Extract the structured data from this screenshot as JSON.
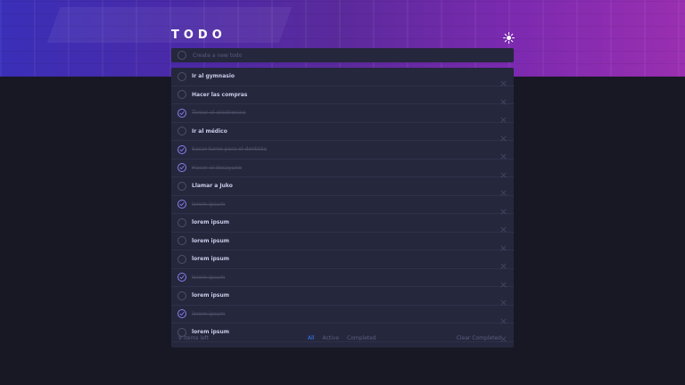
{
  "header": {
    "title": "TODO",
    "theme_toggle_icon": "sun-icon"
  },
  "create": {
    "placeholder": "Create a new todo"
  },
  "todos": [
    {
      "text": "Ir al gymnasio",
      "completed": false
    },
    {
      "text": "Hacer las compras",
      "completed": false
    },
    {
      "text": "Tomar el electronico",
      "completed": true
    },
    {
      "text": "Ir al médico",
      "completed": false
    },
    {
      "text": "Sacar turno para el dentista",
      "completed": true
    },
    {
      "text": "Hacer el desayuno",
      "completed": true
    },
    {
      "text": "Llamar a Juko",
      "completed": false
    },
    {
      "text": "lorem ipsum",
      "completed": true
    },
    {
      "text": "lorem ipsum",
      "completed": false
    },
    {
      "text": "lorem ipsum",
      "completed": false
    },
    {
      "text": "lorem ipsum",
      "completed": false
    },
    {
      "text": "lorem ipsum",
      "completed": true
    },
    {
      "text": "lorem ipsum",
      "completed": false
    },
    {
      "text": "lorem ipsum",
      "completed": true
    },
    {
      "text": "lorem ipsum",
      "completed": false
    }
  ],
  "footer": {
    "items_left": "9 items left",
    "filters": {
      "all": "All",
      "active": "Active",
      "completed": "Completed"
    },
    "clear": "Clear Completed"
  },
  "colors": {
    "accent": "#3a7cfd",
    "check": "#8a7ff0",
    "panel": "#25273d",
    "background": "#171823"
  }
}
